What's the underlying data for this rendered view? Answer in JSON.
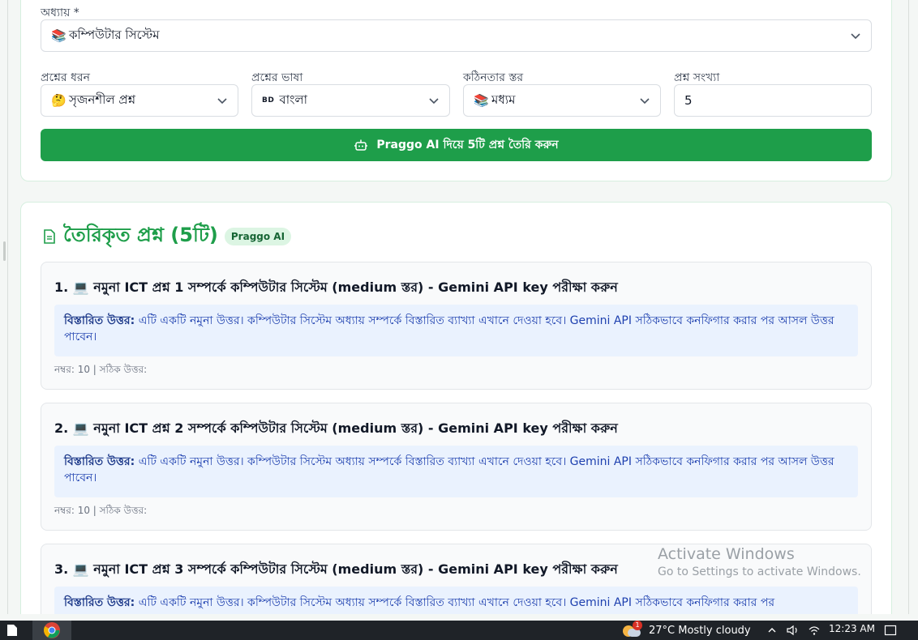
{
  "form": {
    "chapter_label": "অধ্যায় *",
    "chapter_value": "কম্পিউটার সিস্টেম",
    "type_label": "প্রশ্নের ধরন",
    "type_value": "সৃজনশীল প্রশ্ন",
    "language_label": "প্রশ্নের ভাষা",
    "language_flag": "BD",
    "language_value": "বাংলা",
    "difficulty_label": "কঠিনতার স্তর",
    "difficulty_value": "মধ্যম",
    "count_label": "প্রশ্ন সংখ্যা",
    "count_value": "5",
    "generate_label": "Praggo AI দিয়ে 5টি প্রশ্ন তৈরি করুন"
  },
  "results": {
    "title": "তৈরিকৃত প্রশ্ন (5টি)",
    "badge": "Praggo AI",
    "questions": [
      {
        "title": "1. 💻 নমুনা ICT প্রশ্ন 1 সম্পর্কে কম্পিউটার সিস্টেম (medium স্তর) - Gemini API key পরীক্ষা করুন",
        "answer_label": "বিস্তারিত উত্তর:",
        "answer_text": "এটি একটি নমুনা উত্তর। কম্পিউটার সিস্টেম অধ্যায় সম্পর্কে বিস্তারিত ব্যাখ্যা এখানে দেওয়া হবে। Gemini API সঠিকভাবে কনফিগার করার পর আসল উত্তর পাবেন।",
        "meta": "নম্বর: 10 | সঠিক উত্তর:"
      },
      {
        "title": "2. 💻 নমুনা ICT প্রশ্ন 2 সম্পর্কে কম্পিউটার সিস্টেম (medium স্তর) - Gemini API key পরীক্ষা করুন",
        "answer_label": "বিস্তারিত উত্তর:",
        "answer_text": "এটি একটি নমুনা উত্তর। কম্পিউটার সিস্টেম অধ্যায় সম্পর্কে বিস্তারিত ব্যাখ্যা এখানে দেওয়া হবে। Gemini API সঠিকভাবে কনফিগার করার পর আসল উত্তর পাবেন।",
        "meta": "নম্বর: 10 | সঠিক উত্তর:"
      },
      {
        "title": "3. 💻 নমুনা ICT প্রশ্ন 3 সম্পর্কে কম্পিউটার সিস্টেম (medium স্তর) - Gemini API key পরীক্ষা করুন",
        "answer_label": "বিস্তারিত উত্তর:",
        "answer_text": "এটি একটি নমুনা উত্তর। কম্পিউটার সিস্টেম অধ্যায় সম্পর্কে বিস্তারিত ব্যাখ্যা এখানে দেওয়া হবে। Gemini API সঠিকভাবে কনফিগার করার পর",
        "meta": ""
      }
    ]
  },
  "watermark": {
    "line1": "Activate Windows",
    "line2": "Go to Settings to activate Windows."
  },
  "taskbar": {
    "weather_badge": "1",
    "weather": "27°C  Mostly cloudy",
    "time": "12:23 AM"
  },
  "colors": {
    "accent": "#1e9e4a",
    "answer_bg": "#eaf2fe",
    "answer_text": "#1e40af"
  }
}
